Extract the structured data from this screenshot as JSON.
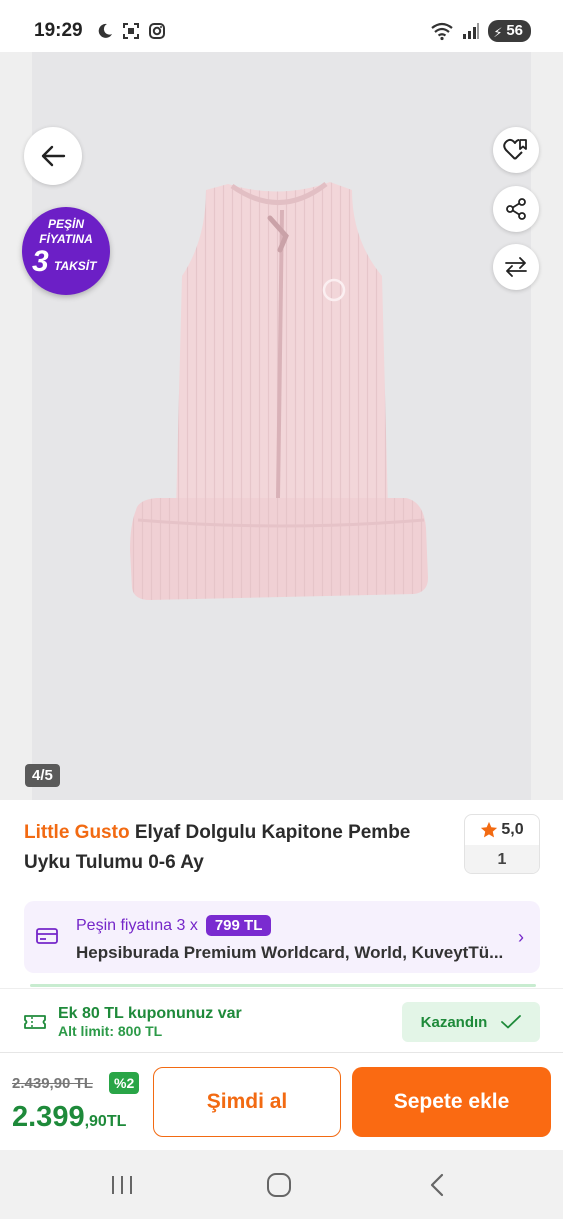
{
  "status_bar": {
    "time": "19:29",
    "battery": "56",
    "icons_left": [
      "moon-icon",
      "screenshot-icon",
      "instagram-icon"
    ],
    "icons_right": [
      "wifi-icon",
      "signal-icon",
      "battery-icon"
    ]
  },
  "gallery": {
    "promo_badge": {
      "line1": "PEŞİN",
      "line2": "FİYATINA",
      "line3": "3",
      "line4": "TAKSİT"
    },
    "counter": "4/5",
    "icons": [
      "back-arrow-icon",
      "favorite-heart-icon",
      "share-icon",
      "compare-icon"
    ]
  },
  "product": {
    "brand": "Little Gusto",
    "name": " Elyaf Dolgulu Kapitone Pembe Uyku Tulumu 0-6 Ay",
    "rating": "5,0",
    "review_count": "1"
  },
  "installment": {
    "prefix": "Peşin fiyatına 3 x",
    "amount": "799 TL",
    "banks": "Hepsiburada Premium Worldcard, World, KuveytTü..."
  },
  "coupon": {
    "title": "Ek 80 TL kuponunuz var",
    "subtitle": "Alt limit: 800 TL",
    "action": "Kazandın"
  },
  "pricing": {
    "old_price": "2.439,90 TL",
    "discount": "%2",
    "new_price_main": "2.399",
    "new_price_decimal": ",90TL"
  },
  "actions": {
    "buy_now": "Şimdi al",
    "add_to_cart": "Sepete ekle"
  },
  "colors": {
    "brand_orange": "#f26a12",
    "accent_purple": "#7a2bd0",
    "success_green": "#1e8a3a",
    "product_pink": "#f2d6d9"
  }
}
